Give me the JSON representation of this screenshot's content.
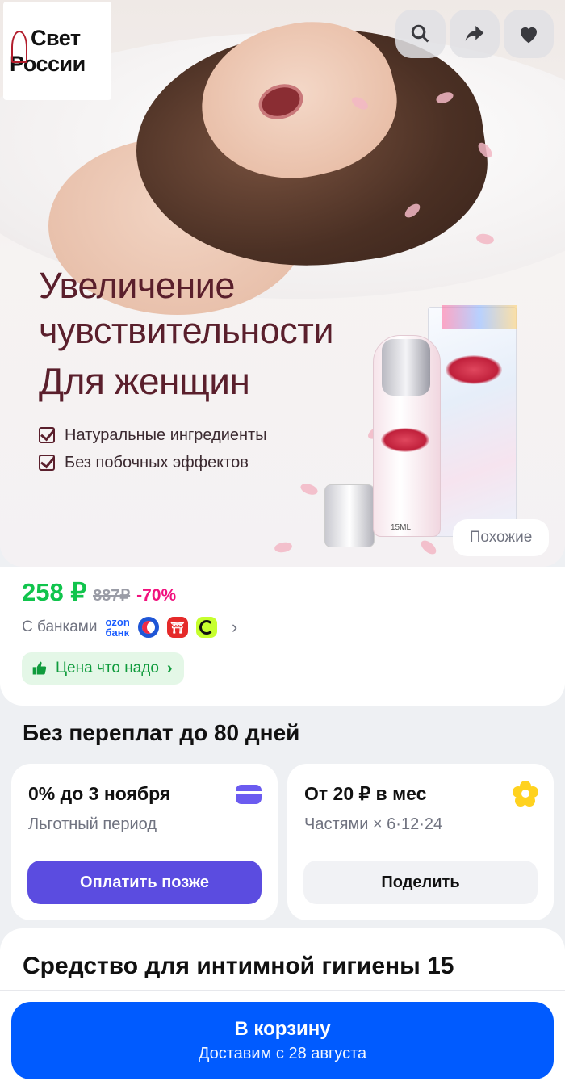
{
  "hero": {
    "brand_line1": "Свет",
    "brand_line2": "России",
    "headline_line1": "Увеличение",
    "headline_line2": "чувствительности",
    "headline_line3": "Для женщин",
    "bullets": [
      "Натуральные ингредиенты",
      "Без побочных эффектов"
    ],
    "bottle_label": "15ML",
    "similar_label": "Похожие",
    "icons": [
      "search-icon",
      "share-icon",
      "heart-icon"
    ]
  },
  "price": {
    "current": "258 ₽",
    "old": "887₽",
    "discount": "-70%",
    "banks_label": "С банками",
    "ozon_bank": [
      "ozon",
      "банк"
    ],
    "deal_label": "Цена что надо",
    "colors": {
      "price": "#10c44c",
      "discount": "#f1117e"
    }
  },
  "installments": {
    "title": "Без переплат до 80 дней",
    "left": {
      "title": "0% до 3 ноября",
      "subtitle": "Льготный период",
      "button": "Оплатить позже"
    },
    "right": {
      "title": "От 20 ₽ в мес",
      "subtitle": "Частями × 6·12·24",
      "button": "Поделить"
    }
  },
  "product": {
    "title": "Средство для интимной гигиены 15"
  },
  "cart": {
    "button": "В корзину",
    "delivery": "Доставим с 28 августа",
    "color": "#005bff"
  }
}
